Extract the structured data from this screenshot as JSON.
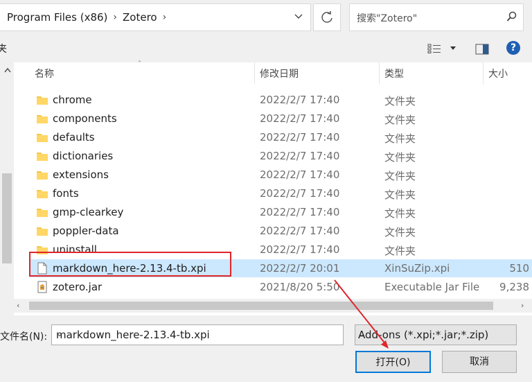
{
  "address": {
    "crumbs": [
      "Program Files (x86)",
      "Zotero"
    ]
  },
  "search": {
    "placeholder": "搜索\"Zotero\""
  },
  "toolbar": {
    "left_fragment": "夹"
  },
  "columns": {
    "name": "名称",
    "date": "修改日期",
    "type": "类型",
    "size": "大小"
  },
  "files": [
    {
      "name": "chrome",
      "date": "2022/2/7 17:40",
      "type": "文件夹",
      "size": "",
      "kind": "folder"
    },
    {
      "name": "components",
      "date": "2022/2/7 17:40",
      "type": "文件夹",
      "size": "",
      "kind": "folder"
    },
    {
      "name": "defaults",
      "date": "2022/2/7 17:40",
      "type": "文件夹",
      "size": "",
      "kind": "folder"
    },
    {
      "name": "dictionaries",
      "date": "2022/2/7 17:40",
      "type": "文件夹",
      "size": "",
      "kind": "folder"
    },
    {
      "name": "extensions",
      "date": "2022/2/7 17:40",
      "type": "文件夹",
      "size": "",
      "kind": "folder"
    },
    {
      "name": "fonts",
      "date": "2022/2/7 17:40",
      "type": "文件夹",
      "size": "",
      "kind": "folder"
    },
    {
      "name": "gmp-clearkey",
      "date": "2022/2/7 17:40",
      "type": "文件夹",
      "size": "",
      "kind": "folder"
    },
    {
      "name": "poppler-data",
      "date": "2022/2/7 17:40",
      "type": "文件夹",
      "size": "",
      "kind": "folder"
    },
    {
      "name": "uninstall",
      "date": "2022/2/7 17:40",
      "type": "文件夹",
      "size": "",
      "kind": "folder"
    },
    {
      "name": "markdown_here-2.13.4-tb.xpi",
      "date": "2022/2/7 20:01",
      "type": "XinSuZip.xpi",
      "size": "510",
      "kind": "file",
      "selected": true
    },
    {
      "name": "zotero.jar",
      "date": "2021/8/20 5:50",
      "type": "Executable Jar File",
      "size": "9,238",
      "kind": "jar"
    }
  ],
  "bottom": {
    "filename_label": "文件名(N):",
    "filename_value": "markdown_here-2.13.4-tb.xpi",
    "filetype_value": "Add-ons (*.xpi;*.jar;*.zip)",
    "open_label": "打开(O)",
    "cancel_label": "取消"
  },
  "colors": {
    "selection": "#cce8ff",
    "highlight_box": "#e0252b",
    "accent": "#0078d7"
  }
}
